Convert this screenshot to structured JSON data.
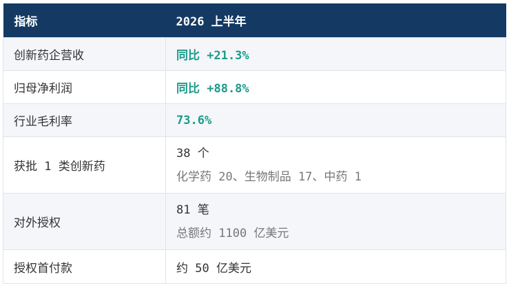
{
  "header": {
    "col1": "指标",
    "col2": "2026 上半年"
  },
  "rows": [
    {
      "label": "创新药企营收",
      "value": "同比 +21.3%"
    },
    {
      "label": "归母净利润",
      "value": "同比 +88.8%"
    },
    {
      "label": "行业毛利率",
      "value": "73.6%"
    },
    {
      "label": "获批 1 类创新药",
      "value": "38 个",
      "detail": "化学药 20、生物制品 17、中药 1"
    },
    {
      "label": "对外授权",
      "value": "81 笔",
      "detail": "总额约 1100 亿美元"
    },
    {
      "label": "授权首付款",
      "value": "约 50 亿美元"
    }
  ],
  "colors": {
    "header_bg": "#143a63",
    "highlight": "#1a9a8a"
  }
}
